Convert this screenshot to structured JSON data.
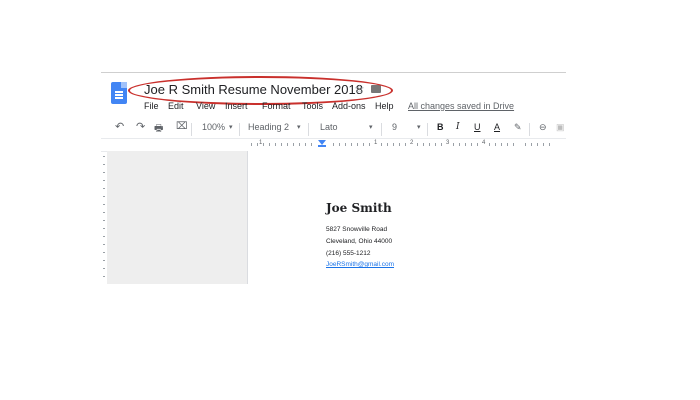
{
  "app": {
    "doc_title": "Joe R Smith Resume November 2018"
  },
  "menu": {
    "items": [
      "File",
      "Edit",
      "View",
      "Insert",
      "Format",
      "Tools",
      "Add-ons",
      "Help"
    ],
    "status": "All changes saved in Drive"
  },
  "toolbar": {
    "undo_icon": "↶",
    "redo_icon": "↷",
    "print_icon": "🖶",
    "paint_icon": "⌧",
    "zoom": "100%",
    "style": "Heading 2",
    "font": "Lato",
    "size": "9",
    "bold": "B",
    "italic": "I",
    "underline": "U",
    "text_color": "A",
    "highlight_icon": "✎",
    "link_icon": "⊖",
    "dropdown": "▾"
  },
  "ruler": {
    "labels": [
      "1",
      "1",
      "2",
      "3",
      "4"
    ]
  },
  "document": {
    "name": "Joe Smith",
    "address": "5827 Snowville Road",
    "city": "Cleveland, Ohio 44000",
    "phone": "(216) 555-1212",
    "email": "JoeRSmith@gmail.com"
  },
  "colors": {
    "annotation_oval": "#c9302c",
    "docs_blue": "#4285f4"
  }
}
